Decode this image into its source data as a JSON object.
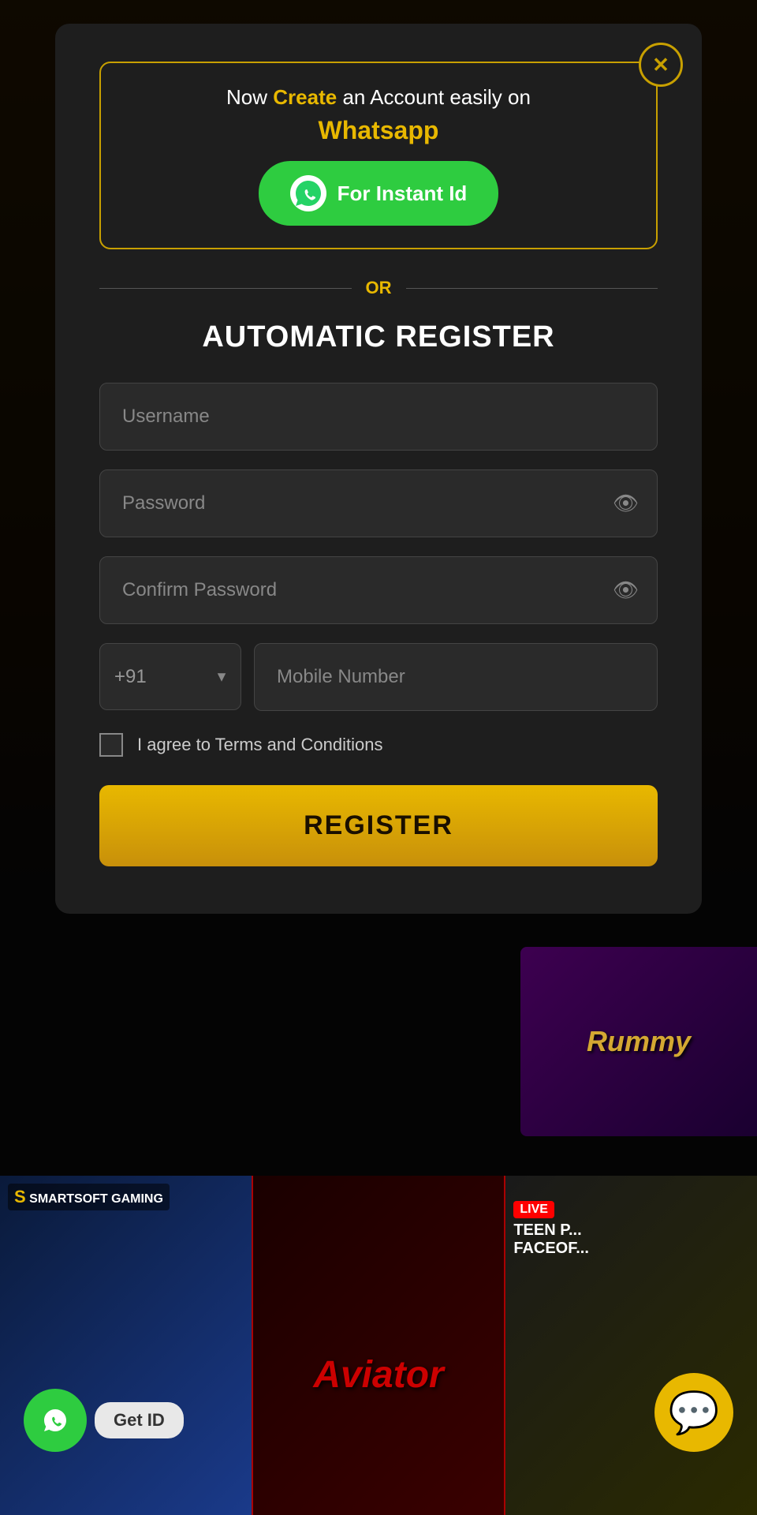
{
  "modal": {
    "close_label": "✕",
    "whatsapp_intro": "Now",
    "whatsapp_highlight": "Create",
    "whatsapp_suffix": " an Account easily on",
    "whatsapp_name": "Whatsapp",
    "whatsapp_btn_text": "For Instant Id",
    "or_text": "OR",
    "section_title": "AUTOMATIC REGISTER",
    "form": {
      "username_placeholder": "Username",
      "password_placeholder": "Password",
      "confirm_password_placeholder": "Confirm Password",
      "country_code": "+91",
      "mobile_placeholder": "Mobile Number",
      "terms_text": "I agree to Terms and Conditions",
      "register_btn": "REGISTER"
    }
  },
  "games": {
    "rummy_label": "Rummy",
    "aviator_label": "Aviator",
    "live_badge": "LIVE",
    "teenpatti_label": "TEEN P...",
    "faceoff_label": "FACEOF...",
    "smartsoft_label": "SMARTSOFT GAMING"
  },
  "bottom_float": {
    "whatsapp_icon": "📱",
    "get_id_label": "Get ID",
    "chat_icon": "💬"
  }
}
